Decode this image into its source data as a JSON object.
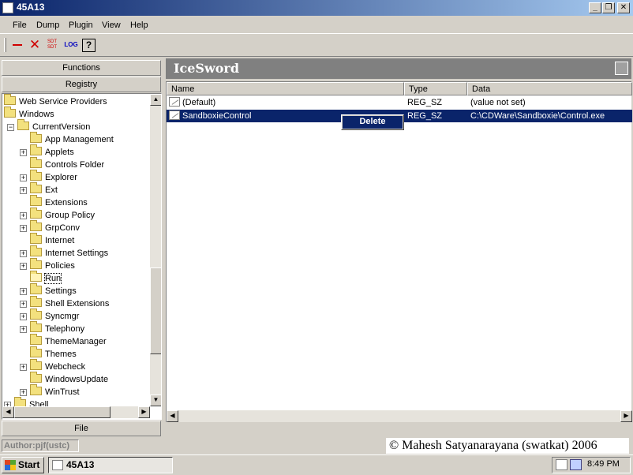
{
  "window": {
    "title": "45A13"
  },
  "title_buttons": {
    "minimize": "_",
    "restore": "❐",
    "close": "✕"
  },
  "menu": [
    "File",
    "Dump",
    "Plugin",
    "View",
    "Help"
  ],
  "toolbar": {
    "tools": [
      {
        "name": "minimize-tool",
        "glyph": "—",
        "color": "#d00000"
      },
      {
        "name": "close-tool",
        "glyph": "✕",
        "color": "#d00000"
      },
      {
        "name": "sdt-tool",
        "glyph": "SDT",
        "color": "#d00000"
      },
      {
        "name": "log-tool",
        "glyph": "LOG",
        "color": "#0000c0"
      },
      {
        "name": "help-tool",
        "glyph": "?",
        "color": "#000000"
      }
    ]
  },
  "left_panel": {
    "functions_label": "Functions",
    "registry_label": "Registry",
    "file_label": "File",
    "tree": [
      {
        "label": "Web Service Providers",
        "indent": 0,
        "expander": ""
      },
      {
        "label": "Windows",
        "indent": 0,
        "expander": ""
      },
      {
        "label": "CurrentVersion",
        "indent": 1,
        "expander": "-"
      },
      {
        "label": "App Management",
        "indent": 2,
        "expander": ""
      },
      {
        "label": "Applets",
        "indent": 2,
        "expander": "+"
      },
      {
        "label": "Controls Folder",
        "indent": 2,
        "expander": ""
      },
      {
        "label": "Explorer",
        "indent": 2,
        "expander": "+"
      },
      {
        "label": "Ext",
        "indent": 2,
        "expander": "+"
      },
      {
        "label": "Extensions",
        "indent": 2,
        "expander": ""
      },
      {
        "label": "Group Policy",
        "indent": 2,
        "expander": "+"
      },
      {
        "label": "GrpConv",
        "indent": 2,
        "expander": "+"
      },
      {
        "label": "Internet",
        "indent": 2,
        "expander": ""
      },
      {
        "label": "Internet Settings",
        "indent": 2,
        "expander": "+"
      },
      {
        "label": "Policies",
        "indent": 2,
        "expander": "+"
      },
      {
        "label": "Run",
        "indent": 2,
        "expander": "",
        "selected": true
      },
      {
        "label": "Settings",
        "indent": 2,
        "expander": "+"
      },
      {
        "label": "Shell Extensions",
        "indent": 2,
        "expander": "+"
      },
      {
        "label": "Syncmgr",
        "indent": 2,
        "expander": "+"
      },
      {
        "label": "Telephony",
        "indent": 2,
        "expander": "+"
      },
      {
        "label": "ThemeManager",
        "indent": 2,
        "expander": ""
      },
      {
        "label": "Themes",
        "indent": 2,
        "expander": ""
      },
      {
        "label": "Webcheck",
        "indent": 2,
        "expander": "+"
      },
      {
        "label": "WindowsUpdate",
        "indent": 2,
        "expander": ""
      },
      {
        "label": "WinTrust",
        "indent": 2,
        "expander": "+"
      },
      {
        "label": "Shell",
        "indent": 0,
        "expander": "+"
      }
    ]
  },
  "banner": {
    "title": "IceSword"
  },
  "listview": {
    "columns": [
      "Name",
      "Type",
      "Data"
    ],
    "rows": [
      {
        "name": "(Default)",
        "type": "REG_SZ",
        "data": "(value not set)",
        "selected": false
      },
      {
        "name": "SandboxieControl",
        "type": "REG_SZ",
        "data": "C:\\CDWare\\Sandboxie\\Control.exe",
        "selected": true
      }
    ]
  },
  "context_menu": {
    "items": [
      "Delete"
    ]
  },
  "status": {
    "author": "Author:pjf(ustc)",
    "credit": "© Mahesh Satyanarayana (swatkat) 2006"
  },
  "taskbar": {
    "start": "Start",
    "task": "45A13",
    "clock": "8:49 PM"
  },
  "colors": {
    "title_gradient_start": "#0a246a",
    "title_gradient_end": "#a6caf0",
    "selection": "#0a246a",
    "face": "#d4d0c8"
  }
}
